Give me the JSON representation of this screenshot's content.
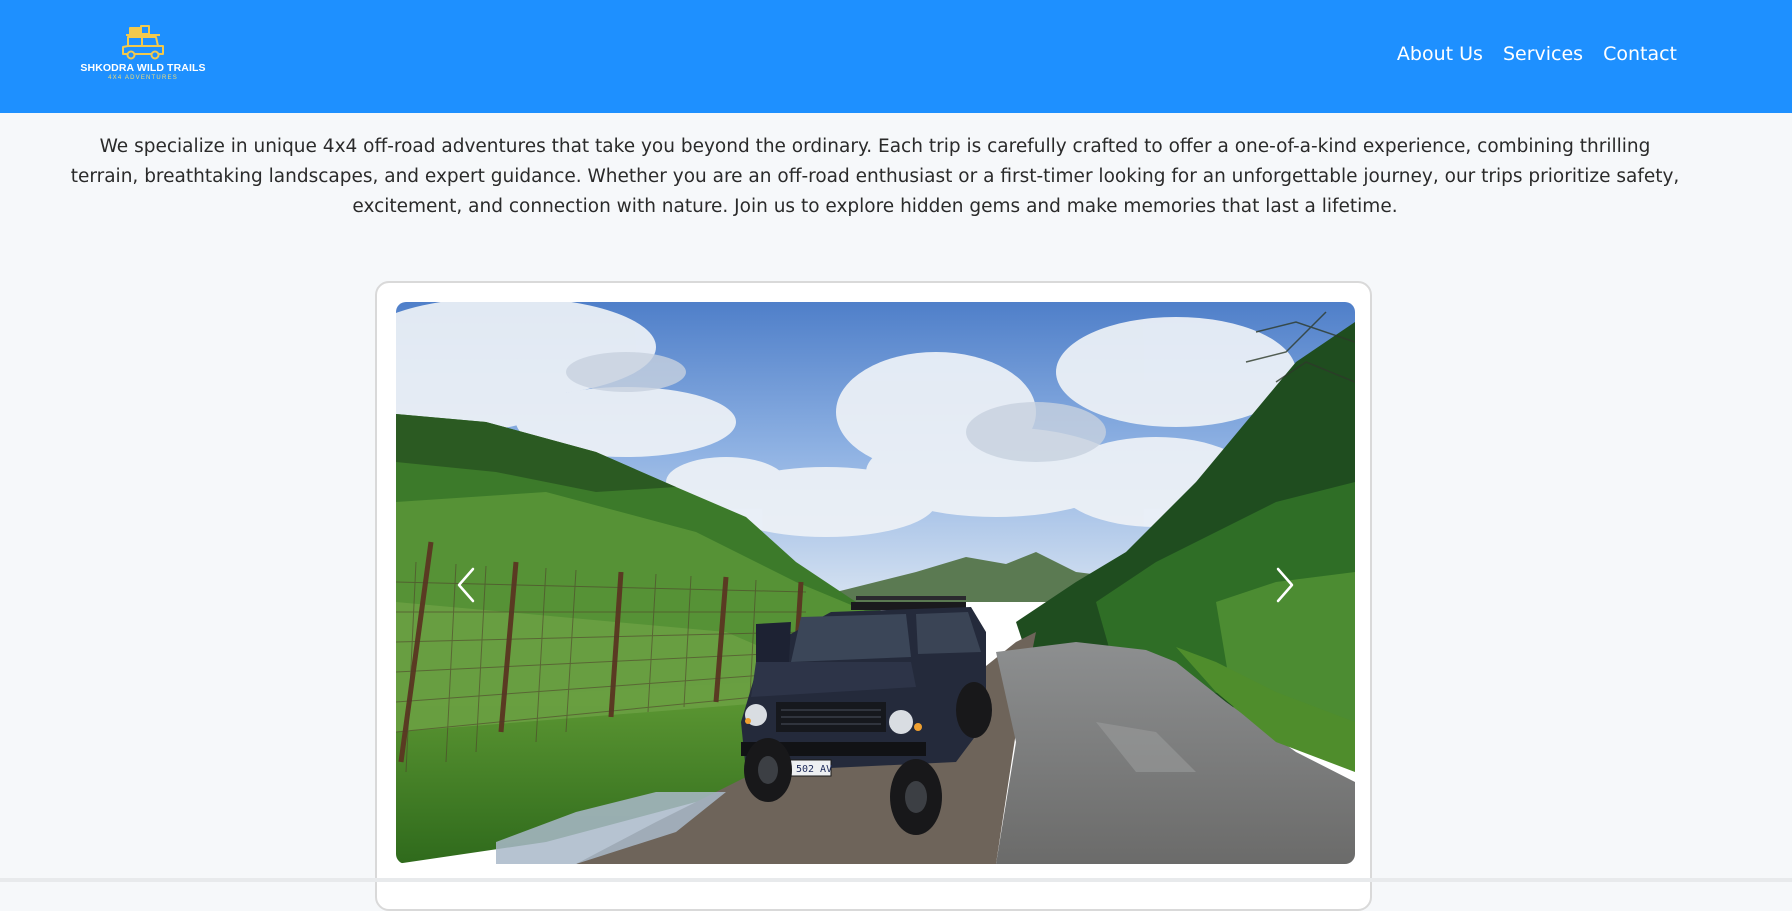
{
  "navbar": {
    "logo": {
      "title": "SHKODRA WILD TRAILS",
      "subtitle": "4X4 ADVENTURES",
      "icon": "jeep-with-roof-rack-icon"
    },
    "links": [
      {
        "label": "About Us"
      },
      {
        "label": "Services"
      },
      {
        "label": "Contact"
      }
    ],
    "colors": {
      "background": "#1e90ff",
      "text": "#ffffff",
      "logo_accent": "#f2c94c"
    }
  },
  "intro": {
    "text": "We specialize in unique 4x4 off-road adventures that take you beyond the ordinary. Each trip is carefully crafted to offer a one-of-a-kind experience, combining thrilling terrain, breathtaking landscapes, and expert guidance. Whether you are an off-road enthusiast or a first-timer looking for an unforgettable journey, our trips prioritize safety, excitement, and connection with nature. Join us to explore hidden gems and make memories that last a lifetime."
  },
  "carousel": {
    "image": {
      "plate": "AA 502 AV"
    },
    "controls": {
      "prev_icon": "chevron-left-icon",
      "next_icon": "chevron-right-icon"
    }
  }
}
